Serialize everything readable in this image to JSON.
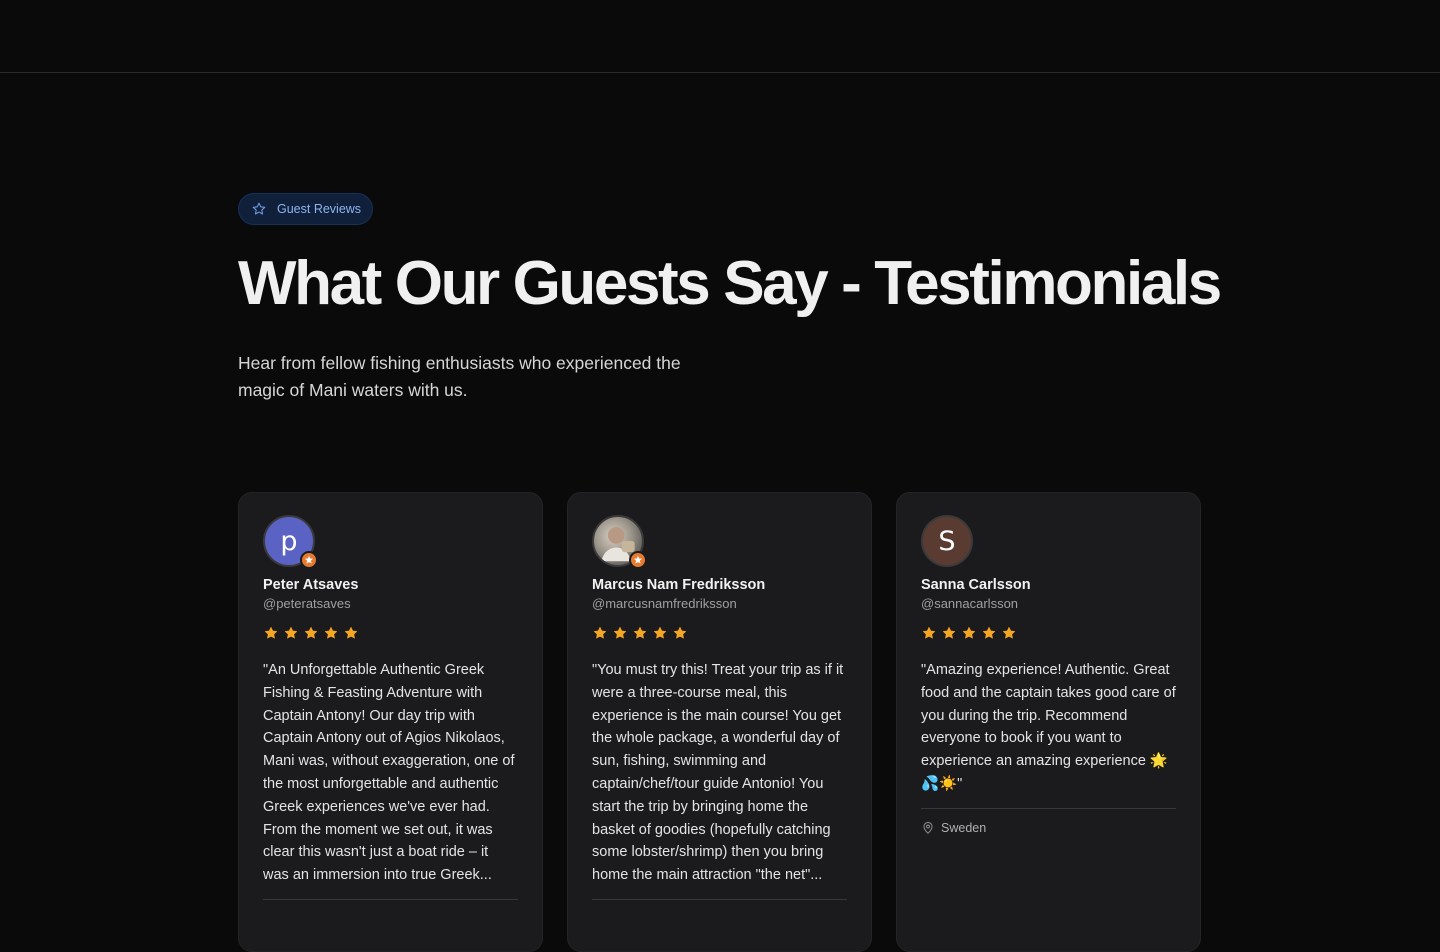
{
  "badge": {
    "label": "Guest Reviews",
    "icon": "star-outline-icon",
    "accent": "#8db4f0"
  },
  "hero": {
    "title": "What Our Guests Say - Testimonials",
    "subtitle": "Hear from fellow fishing enthusiasts who experienced the magic of Mani waters with us."
  },
  "colors": {
    "star": "#f5a623",
    "verified": "#e67a2e",
    "background": "#0a0a0a",
    "card": "#1b1b1d"
  },
  "reviews": [
    {
      "avatar_letter": "p",
      "name": "Peter Atsaves",
      "handle": "@peteratsaves",
      "rating": 5,
      "quote": "\"An Unforgettable Authentic Greek Fishing & Feasting Adventure with Captain Antony! Our day trip with Captain Antony out of Agios Nikolaos, Mani was, without exaggeration, one of the most unforgettable and authentic Greek experiences we've ever had. From the moment we set out, it was clear this wasn't just a boat ride – it was an immersion into true Greek..."
    },
    {
      "avatar_letter": "",
      "name": "Marcus Nam Fredriksson",
      "handle": "@marcusnamfredriksson",
      "rating": 5,
      "quote": "\"You must try this! Treat your trip as if it were a three-course meal, this experience is the main course! You get the whole package, a wonderful day of sun, fishing, swimming and captain/chef/tour guide Antonio! You start the trip by bringing home the basket of goodies (hopefully catching some lobster/shrimp) then you bring home the main attraction \"the net\"..."
    },
    {
      "avatar_letter": "S",
      "name": "Sanna Carlsson",
      "handle": "@sannacarlsson",
      "rating": 5,
      "quote": "\"Amazing experience! Authentic. Great food and the captain takes good care of you during the trip. Recommend everyone to book if you want to experience an amazing experience 🌟💦☀️\"",
      "location": "Sweden"
    }
  ]
}
